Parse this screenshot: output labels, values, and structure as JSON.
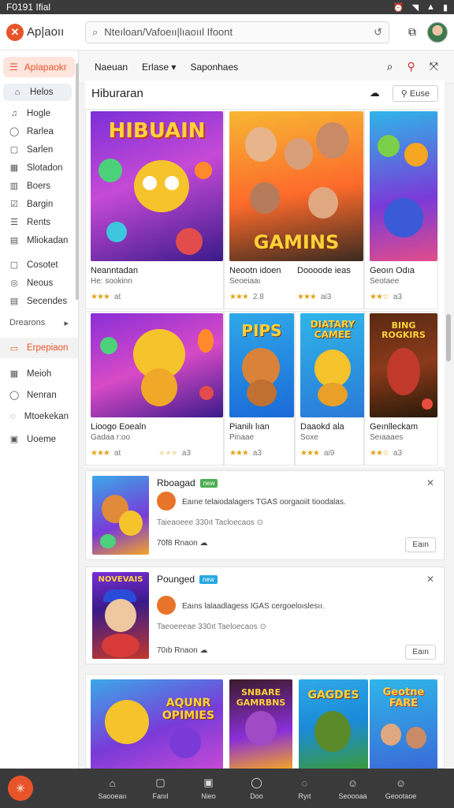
{
  "status_bar": {
    "time": "F0191 Ifial",
    "icons": [
      "alarm-icon",
      "wifi-icon",
      "signal-icon",
      "battery-icon"
    ]
  },
  "app_bar": {
    "logo_text": "Ap|aoıı",
    "search_text": "Nteıloan/Vafoeıı|lıaoııl Ifoont",
    "accent_color": "#e8542a"
  },
  "sidebar": {
    "primary": "Aplapaokr",
    "items": [
      {
        "label": "Helos",
        "icon": "home-icon"
      },
      {
        "label": "Hogle",
        "icon": "bell-icon"
      },
      {
        "label": "Rarlea",
        "icon": "chat-icon"
      },
      {
        "label": "Sarlen",
        "icon": "square-icon"
      },
      {
        "label": "Slotadon",
        "icon": "grid-icon"
      },
      {
        "label": "Boers",
        "icon": "bag-icon"
      },
      {
        "label": "Bargin",
        "icon": "check-icon"
      },
      {
        "label": "Rents",
        "icon": "list-icon"
      },
      {
        "label": "Mliokadan",
        "icon": "doc-icon"
      },
      {
        "label": "Cosotet",
        "icon": "square-icon"
      },
      {
        "label": "Neous",
        "icon": "pin-icon"
      },
      {
        "label": "Secendes",
        "icon": "list-icon"
      }
    ],
    "section_label": "Drearons",
    "active_orange": "Erpepiaon",
    "items2": [
      {
        "label": "Meioh",
        "icon": "grid-icon"
      },
      {
        "label": "Nenran",
        "icon": "chat-icon"
      },
      {
        "label": "Mtoekekan",
        "icon": "bubble-icon"
      },
      {
        "label": "Uoeme",
        "icon": "shield-icon"
      }
    ]
  },
  "tabbar": {
    "tab1": "Naeuan",
    "tab2": "Erlase",
    "tab3": "Saponhaes"
  },
  "section": {
    "title": "Hiburaran",
    "button": "Euse"
  },
  "grid": {
    "row1": [
      {
        "title_art": "HIBUAIN",
        "name": "Neanntadan",
        "sub": "He: sookinn",
        "stars": "★★★",
        "rating": "at"
      },
      {
        "title_art": "GAMINS",
        "name": "Neootn idoen",
        "sub": "Seoeiaaı",
        "stars": "★★★",
        "rating": "2.8"
      },
      {
        "title_art": "",
        "name": "Doooode ieas",
        "sub": "",
        "stars": "★★★",
        "rating": "ai3"
      },
      {
        "title_art": "",
        "name": "Geoın Odıa",
        "sub": "Seotaee",
        "stars": "★★☆",
        "rating": "a3"
      }
    ],
    "row2": [
      {
        "title_art": "",
        "name": "Lioogo Eoealn",
        "sub": "Gadaa r:oo",
        "stars": "★★★",
        "rating": "at"
      },
      {
        "title_art": "",
        "name": "",
        "sub": "",
        "stars": "★★★",
        "rating": "a3"
      },
      {
        "title_art": "PIPS",
        "name": "Pianilı lıan",
        "sub": "Pinaae",
        "stars": "★★★",
        "rating": "a3"
      },
      {
        "title_art": "DIATARY CAMEE",
        "name": "Daaokd ala",
        "sub": "Soxe",
        "stars": "★★★",
        "rating": "ai9"
      },
      {
        "title_art": "BING ROGKIRS",
        "name": "Geınlleckam",
        "sub": "Seıaaaes",
        "stars": "★★☆",
        "rating": "a3"
      }
    ]
  },
  "featured": [
    {
      "title": "Rboagad",
      "badge": "new",
      "badge_color": "#4caf50",
      "desc": "Eaıne telaiodalagers TGAS oorgaoiit tioodalas.",
      "meta": "Taieaoeee 330ıt Tacloecaos",
      "size": "70f8 Rnaon",
      "button": "Eaın",
      "thumb_title": ""
    },
    {
      "title": "Pounged",
      "badge": "new",
      "badge_color": "#29a8e0",
      "desc": "Eaıns lalaadlagess IGAS cergoeloıslesıı.",
      "meta": "Taeoeeeae 330ıt Taeloecaos",
      "size": "70ıb Rnaon",
      "button": "Eaın",
      "thumb_title": "NOVEVAIS"
    }
  ],
  "bottom_row": [
    {
      "title_art": "AQUNR OPIMIES"
    },
    {
      "title_art": "SNBARE GAMRBNS"
    },
    {
      "title_art": "GAGDES"
    },
    {
      "title_art": "Geotne FARE"
    }
  ],
  "bottom_nav": [
    {
      "label": "Saooeaıı",
      "icon": "home-icon"
    },
    {
      "label": "Fanıl",
      "icon": "square-icon"
    },
    {
      "label": "Nieo",
      "icon": "grid-icon"
    },
    {
      "label": "Doo",
      "icon": "chat-icon"
    },
    {
      "label": "Ryıt",
      "icon": "bubble-icon"
    },
    {
      "label": "Seoooaa",
      "icon": "user-icon"
    },
    {
      "label": "Geootaoe",
      "icon": "user-icon"
    }
  ]
}
